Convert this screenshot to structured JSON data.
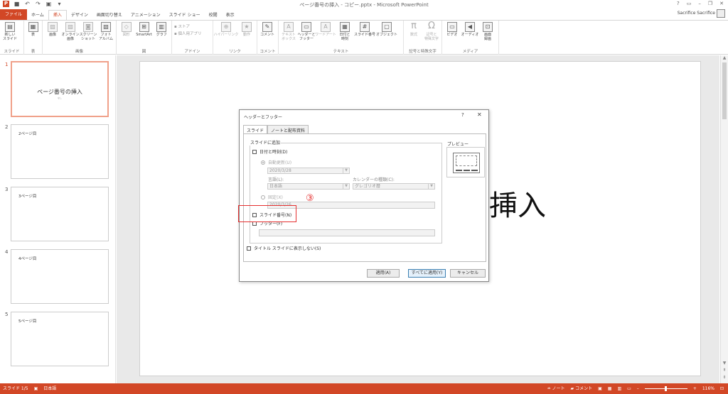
{
  "window": {
    "title": "ページ番号の挿入 - コピー.pptx - Microsoft PowerPoint",
    "help": "?",
    "user": "Sacrifice Sacrifice"
  },
  "tabs": [
    {
      "label": "ファイル",
      "kind": "file"
    },
    {
      "label": "ホーム"
    },
    {
      "label": "挿入",
      "active": true
    },
    {
      "label": "デザイン"
    },
    {
      "label": "画面切り替え"
    },
    {
      "label": "アニメーション"
    },
    {
      "label": "スライド ショー"
    },
    {
      "label": "校閲"
    },
    {
      "label": "表示"
    }
  ],
  "ribbon": {
    "new_slide_1": "新しい",
    "new_slide_2": "スライド",
    "table": "表",
    "image": "画像",
    "online_image_1": "オンライン",
    "online_image_2": "画像",
    "screenshot_1": "スクリーン",
    "screenshot_2": "ショット",
    "photo_album_1": "フォト",
    "photo_album_2": "アルバム",
    "shapes": "図形",
    "smartart": "SmartArt",
    "chart": "グラフ",
    "store": "ストア",
    "my_apps": "個人用アプリ",
    "hyperlink": "ハイパーリンク",
    "action": "動作",
    "comment": "コメント",
    "textbox_1": "テキスト",
    "textbox_2": "ボックス",
    "header_footer_1": "ヘッダーと",
    "header_footer_2": "フッター",
    "wordart": "ワードアート",
    "datetime_1": "日付と",
    "datetime_2": "時刻",
    "slide_number": "スライド番号",
    "object": "オブジェクト",
    "equation": "数式",
    "symbol_1": "記号と",
    "symbol_2": "特殊文字",
    "video": "ビデオ",
    "audio": "オーディオ",
    "screen_rec_1": "画面",
    "screen_rec_2": "録画",
    "groups": {
      "slides": "スライド",
      "tables": "表",
      "images": "画像",
      "illustrations": "図",
      "apps": "アドイン",
      "links": "リンク",
      "comments": "コメント",
      "text": "テキスト",
      "symbols": "記号と特殊文字",
      "media": "メディア"
    }
  },
  "thumbnails": [
    {
      "num": "1",
      "title": "ページ番号の挿入",
      "sub": "なし",
      "selected": true
    },
    {
      "num": "2",
      "text": "2ページ目"
    },
    {
      "num": "3",
      "text": "3ページ目"
    },
    {
      "num": "4",
      "text": "4ページ目"
    },
    {
      "num": "5",
      "text": "5ページ目"
    }
  ],
  "slide": {
    "visible_text": "挿入"
  },
  "dialog": {
    "title": "ヘッダーとフッター",
    "help": "?",
    "close": "✕",
    "tab_slide": "スライド",
    "tab_notes": "ノートと配布資料",
    "group_label": "スライドに追加",
    "datetime": "日付と時刻(D)",
    "auto_update": "自動更新(U)",
    "auto_date": "2020/3/28",
    "language_label": "言語(L):",
    "language_value": "日本語",
    "calendar_label": "カレンダーの種類(C):",
    "calendar_value": "グレゴリオ暦",
    "fixed": "固定(X)",
    "fixed_date": "2020/3/26",
    "slide_number": "スライド番号(N)",
    "footer": "フッター(F)",
    "no_title_slide": "タイトル スライドに表示しない(S)",
    "preview": "プレビュー",
    "btn_apply": "適用(A)",
    "btn_apply_all": "すべてに適用(Y)",
    "btn_cancel": "キャンセル"
  },
  "annotation": {
    "marker": "③",
    "color": "#e53030"
  },
  "statusbar": {
    "slide_pos": "スライド 1/5",
    "language": "日本語",
    "notes": "ノート",
    "comments": "コメント",
    "zoom": "116%"
  },
  "colors": {
    "accent": "#d24726"
  }
}
